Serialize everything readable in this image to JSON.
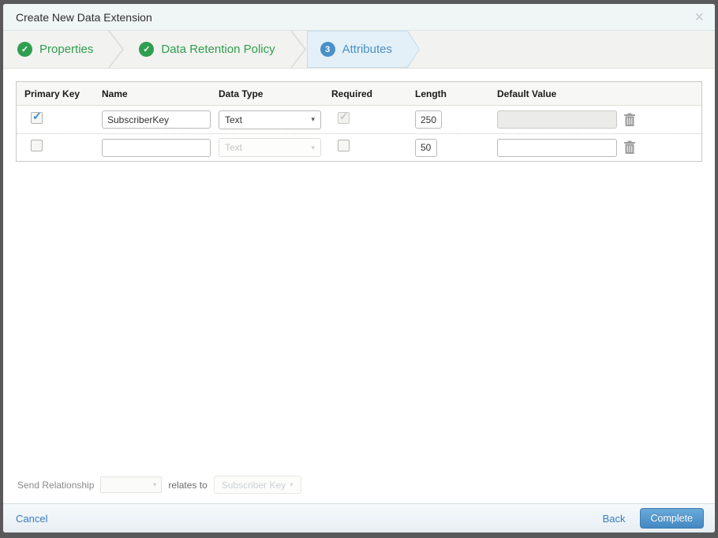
{
  "modal": {
    "title": "Create New Data Extension"
  },
  "icons": {
    "close": "×",
    "caret": "▾",
    "check": "✓"
  },
  "steps": [
    {
      "label": "Properties",
      "state": "complete"
    },
    {
      "label": "Data Retention Policy",
      "state": "complete"
    },
    {
      "label": "Attributes",
      "number": "3",
      "state": "active"
    }
  ],
  "table": {
    "headers": {
      "primary_key": "Primary Key",
      "name": "Name",
      "data_type": "Data Type",
      "required": "Required",
      "length": "Length",
      "default_value": "Default Value"
    },
    "rows": [
      {
        "primary_key_checked": true,
        "name_value": "SubscriberKey",
        "data_type": "Text",
        "data_type_disabled": false,
        "required_checked": true,
        "required_disabled": true,
        "length_value": "250",
        "default_value": "",
        "default_disabled": true
      },
      {
        "primary_key_checked": false,
        "name_value": "",
        "data_type": "Text",
        "data_type_disabled": true,
        "required_checked": false,
        "required_disabled": false,
        "length_value": "50",
        "default_value": "",
        "default_disabled": false
      }
    ]
  },
  "send_relationship": {
    "label": "Send Relationship",
    "relates_to_label": "relates to",
    "relates_to_value": "Subscriber Key"
  },
  "footer": {
    "cancel": "Cancel",
    "back": "Back",
    "complete": "Complete"
  },
  "colors": {
    "step_complete_green": "#2f9e4f",
    "step_active_blue": "#4a90c7",
    "step_active_bg": "#e3f0f8",
    "link_blue": "#3a7cbf",
    "complete_button_blue": "#4388c3",
    "overlay_gray": "#59595b"
  }
}
